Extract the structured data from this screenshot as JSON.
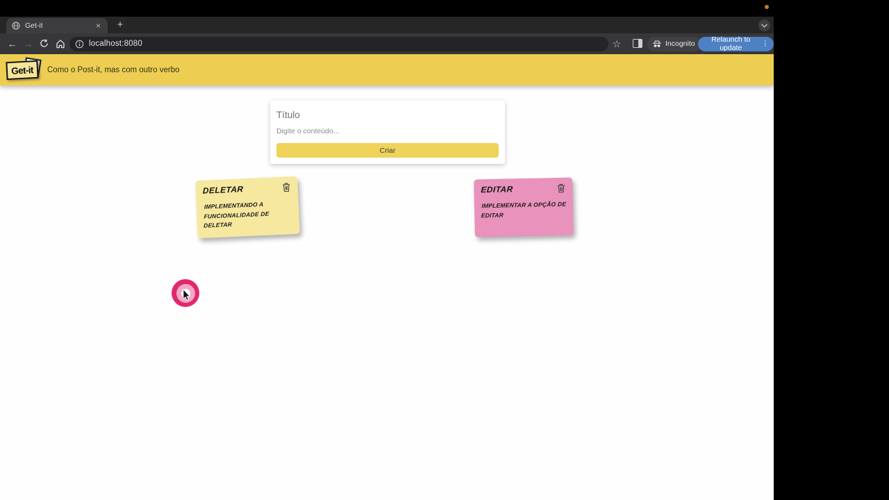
{
  "browser": {
    "tab_title": "Get-it",
    "url": "localhost:8080",
    "incognito_label": "Incognito",
    "relaunch_label": "Relaunch to update",
    "new_tab_glyph": "+",
    "close_glyph": "×",
    "back_glyph": "←",
    "forward_glyph": "→",
    "star_glyph": "☆",
    "menu_dots_glyph": "⋮"
  },
  "header": {
    "logo_text": "Get-it",
    "tagline": "Como o Post-it, mas com outro verbo"
  },
  "form": {
    "title_placeholder": "Título",
    "content_placeholder": "Digite o conteúdo...",
    "submit_label": "Criar"
  },
  "notes": [
    {
      "title": "DELETAR",
      "content": "IMPLEMENTANDO A FUNCIONALIDADE DE DELETAR",
      "color": "#f6e89e"
    },
    {
      "title": "EDITAR",
      "content": "IMPLEMENTAR A OPÇÃO DE EDITAR",
      "color": "#e992bb"
    }
  ],
  "colors": {
    "header_yellow": "#edce52",
    "button_yellow": "#efd35a",
    "relaunch_blue": "#4e80c4",
    "ripple_outer": "#e3276f",
    "ripple_mid": "#f2a8c6"
  }
}
